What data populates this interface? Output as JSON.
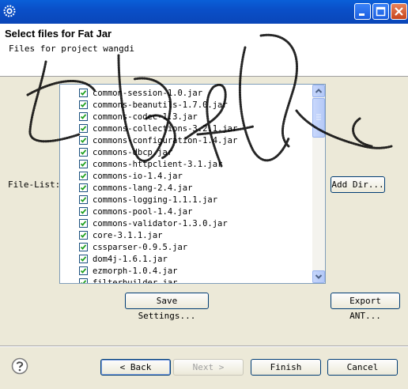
{
  "window": {
    "title": "",
    "controls": {
      "minimize": "minimize",
      "maximize": "maximize",
      "close": "close"
    }
  },
  "header": {
    "title": "Select files for Fat Jar",
    "subtitle": "Files for project wangdi"
  },
  "file_list": {
    "label": "File-List:",
    "items": [
      {
        "name": "common-session-1.0.jar",
        "checked": true
      },
      {
        "name": "commons-beanutils-1.7.0.jar",
        "checked": true
      },
      {
        "name": "commons-codec-1.3.jar",
        "checked": true
      },
      {
        "name": "commons-collections-3.2.1.jar",
        "checked": true
      },
      {
        "name": "commons-configuration-1.4.jar",
        "checked": true
      },
      {
        "name": "commons-dbcp.jar",
        "checked": true
      },
      {
        "name": "commons-httpclient-3.1.jar",
        "checked": true
      },
      {
        "name": "commons-io-1.4.jar",
        "checked": true
      },
      {
        "name": "commons-lang-2.4.jar",
        "checked": true
      },
      {
        "name": "commons-logging-1.1.1.jar",
        "checked": true
      },
      {
        "name": "commons-pool-1.4.jar",
        "checked": true
      },
      {
        "name": "commons-validator-1.3.0.jar",
        "checked": true
      },
      {
        "name": "core-3.1.1.jar",
        "checked": true
      },
      {
        "name": "cssparser-0.9.5.jar",
        "checked": true
      },
      {
        "name": "dom4j-1.6.1.jar",
        "checked": true
      },
      {
        "name": "ezmorph-1.0.4.jar",
        "checked": true
      },
      {
        "name": "filterbuilder.jar",
        "checked": true
      }
    ]
  },
  "buttons": {
    "add_dir": "Add Dir...",
    "save_settings": "Save Settings...",
    "export_ant": "Export ANT...",
    "back": "< Back",
    "next": "Next >",
    "finish": "Finish",
    "cancel": "Cancel"
  },
  "colors": {
    "title_bar": "#0a4fc8",
    "dialog_bg": "#ece9d8",
    "checkbox_check": "#21a121",
    "scribble": "#000000"
  },
  "icons": {
    "app": "eclipse-gear-icon",
    "help": "help-icon"
  }
}
